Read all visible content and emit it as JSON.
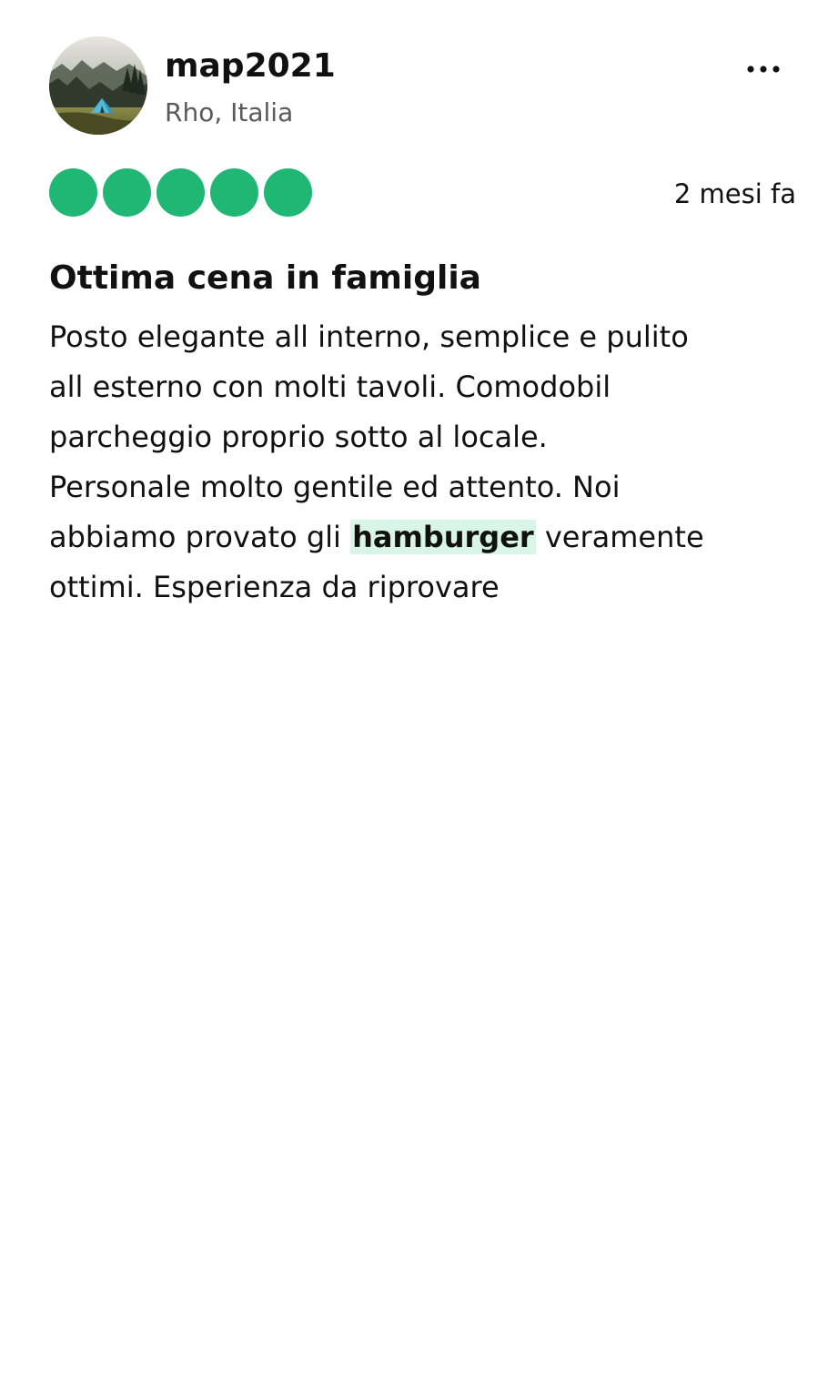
{
  "review": {
    "user": {
      "name": "map2021",
      "location": "Rho, Italia",
      "avatar_icon": "tent-landscape-avatar"
    },
    "more_icon": "more-options-icon",
    "rating": {
      "value": 5,
      "max": 5,
      "color": "#20b673"
    },
    "time_ago": "2 mesi fa",
    "title": "Ottima cena in famiglia",
    "body": {
      "line1": "Posto elegante all interno, semplice e pulito",
      "line2": "all esterno con molti tavoli. Comodobil",
      "line3": "parcheggio proprio sotto al locale.",
      "line4": "Personale molto gentile ed attento. Noi",
      "line5_before": "abbiamo provato gli ",
      "line5_highlight": "hamburger",
      "line5_after": " veramente",
      "line6": "ottimi. Esperienza da riprovare"
    },
    "highlight_color": "#d9f4e8"
  }
}
